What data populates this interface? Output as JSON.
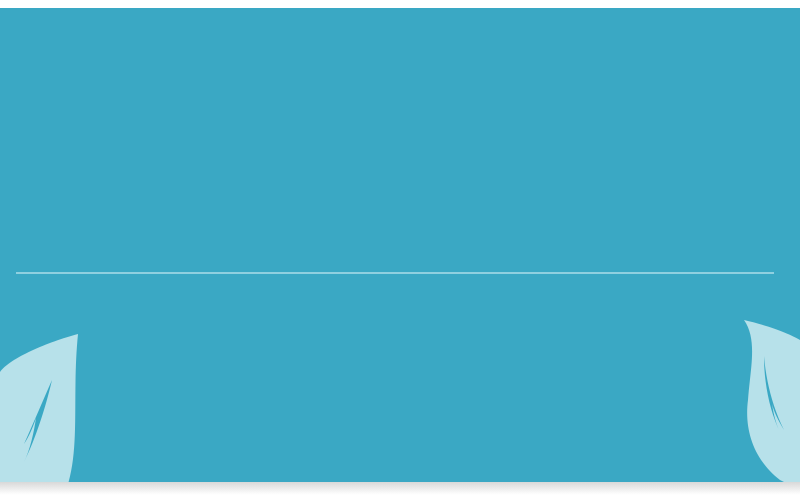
{
  "theme": {
    "panel_color": "#3aa8c4",
    "divider_color": "#8fd0e0",
    "leaf_color": "#b7e1ea"
  },
  "decorations": {
    "left_leaf": "leaf-icon",
    "right_leaf": "leaf-icon"
  }
}
